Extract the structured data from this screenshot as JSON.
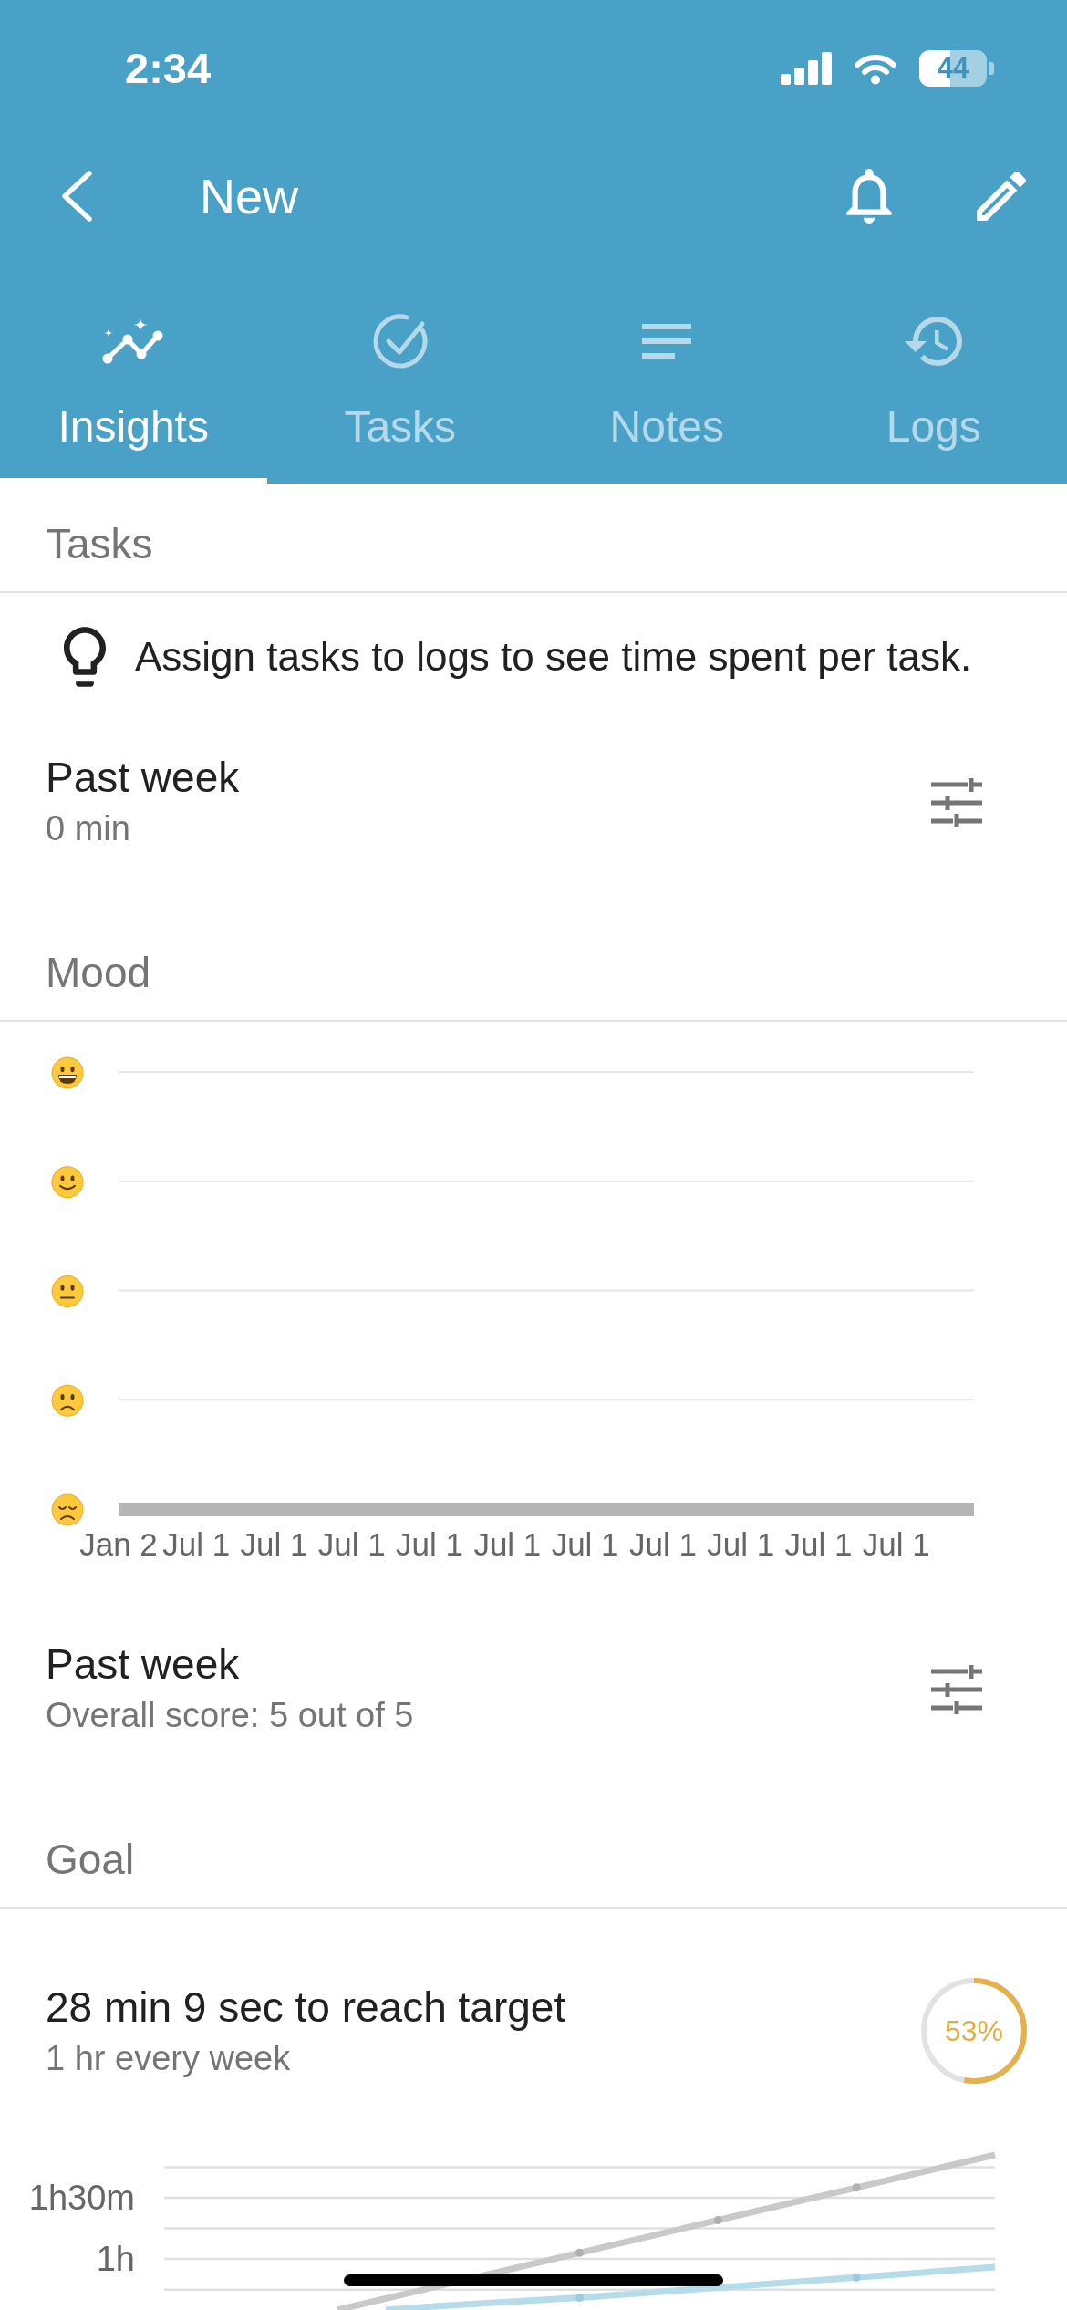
{
  "status_bar": {
    "time": "2:34",
    "battery": "44"
  },
  "nav": {
    "title": "New"
  },
  "tabs": [
    {
      "label": "Insights",
      "kind": "insights",
      "selected": true
    },
    {
      "label": "Tasks",
      "kind": "tasks",
      "selected": false
    },
    {
      "label": "Notes",
      "kind": "notes",
      "selected": false
    },
    {
      "label": "Logs",
      "kind": "logs",
      "selected": false
    }
  ],
  "tasks": {
    "heading": "Tasks",
    "tip": "Assign tasks to logs to see time spent per task.",
    "summary": {
      "title": "Past week",
      "subtitle": "0 min"
    }
  },
  "mood": {
    "heading": "Mood",
    "scale": [
      {
        "kind": "grinning"
      },
      {
        "kind": "smiling"
      },
      {
        "kind": "neutral"
      },
      {
        "kind": "frowning"
      },
      {
        "kind": "disappointed"
      }
    ],
    "x_labels": [
      "Jan 2",
      "Jul 1",
      "Jul 1",
      "Jul 1",
      "Jul 1",
      "Jul 1",
      "Jul 1",
      "Jul 1",
      "Jul 1",
      "Jul 1",
      "Jul 1"
    ],
    "summary": {
      "title": "Past week",
      "subtitle": "Overall score: 5 out of 5"
    }
  },
  "goal": {
    "heading": "Goal",
    "title": "28 min 9 sec to reach target",
    "subtitle": "1 hr every week",
    "level": 0.53,
    "percent": "53%",
    "chart": {
      "y_labels": [
        "1h30m",
        "1h"
      ]
    }
  }
}
